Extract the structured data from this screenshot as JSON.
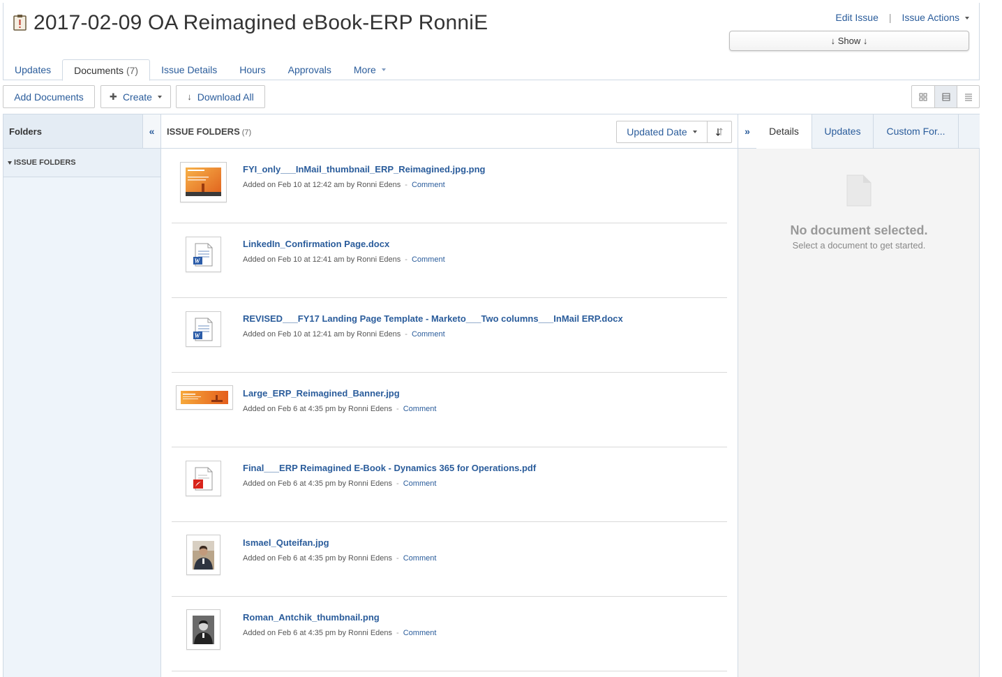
{
  "header": {
    "title": "2017-02-09 OA Reimagined eBook-ERP RonniE",
    "edit_issue": "Edit Issue",
    "separator": "|",
    "issue_actions": "Issue Actions",
    "show_button": "↓ Show ↓"
  },
  "tabs": [
    {
      "label": "Updates"
    },
    {
      "label": "Documents",
      "count": "(7)"
    },
    {
      "label": "Issue Details"
    },
    {
      "label": "Hours"
    },
    {
      "label": "Approvals"
    },
    {
      "label": "More"
    }
  ],
  "toolbar": {
    "add_documents": "Add Documents",
    "create": "Create",
    "download_all": "Download All"
  },
  "folders": {
    "heading": "Folders",
    "collapse": "«",
    "item": "ISSUE FOLDERS"
  },
  "docs": {
    "heading": "ISSUE FOLDERS",
    "count": "(7)",
    "sort_label": "Updated Date",
    "expand": "»",
    "items": [
      {
        "name": "FYI_only___InMail_thumbnail_ERP_Reimagined.jpg.png",
        "meta": "Added on Feb 10 at 12:42 am by Ronni Edens",
        "comment": "Comment",
        "thumb": "orange-image"
      },
      {
        "name": "LinkedIn_Confirmation Page.docx",
        "meta": "Added on Feb 10 at 12:41 am by Ronni Edens",
        "comment": "Comment",
        "thumb": "word-doc"
      },
      {
        "name": "REVISED___FY17 Landing Page Template - Marketo___Two columns___InMail ERP.docx",
        "meta": "Added on Feb 10 at 12:41 am by Ronni Edens",
        "comment": "Comment",
        "thumb": "word-doc"
      },
      {
        "name": "Large_ERP_Reimagined_Banner.jpg",
        "meta": "Added on Feb 6 at 4:35 pm by Ronni Edens",
        "comment": "Comment",
        "thumb": "orange-banner"
      },
      {
        "name": "Final___ERP Reimagined E-Book - Dynamics 365 for Operations.pdf",
        "meta": "Added on Feb 6 at 4:35 pm by Ronni Edens",
        "comment": "Comment",
        "thumb": "pdf-doc"
      },
      {
        "name": "Ismael_Quteifan.jpg",
        "meta": "Added on Feb 6 at 4:35 pm by Ronni Edens",
        "comment": "Comment",
        "thumb": "photo"
      },
      {
        "name": "Roman_Antchik_thumbnail.png",
        "meta": "Added on Feb 6 at 4:35 pm by Ronni Edens",
        "comment": "Comment",
        "thumb": "photo-bw"
      }
    ]
  },
  "details": {
    "tabs": [
      "Details",
      "Updates",
      "Custom For..."
    ],
    "empty_title": "No document selected.",
    "empty_sub": "Select a document to get started."
  },
  "colors": {
    "link": "#2a5c9b",
    "border": "#cfd9e4",
    "folder_bg": "#eef4fa",
    "orange": "#f28c28"
  }
}
